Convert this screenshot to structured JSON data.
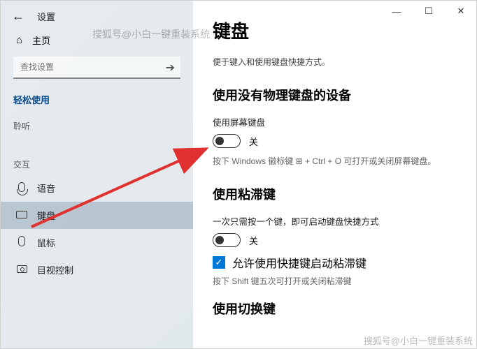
{
  "window": {
    "title": "设置",
    "controls": {
      "min": "—",
      "max": "☐",
      "close": "✕"
    }
  },
  "sidebar": {
    "home": "主页",
    "search_placeholder": "查找设置",
    "category": "轻松使用",
    "group_hearing": "聆听",
    "group_interaction": "交互",
    "items": {
      "speech": "语音",
      "keyboard": "键盘",
      "mouse": "鼠标",
      "eye": "目视控制"
    }
  },
  "main": {
    "title": "键盘",
    "subtitle": "便于键入和使用键盘快捷方式。",
    "sec1": {
      "heading": "使用没有物理键盘的设备",
      "label": "使用屏幕键盘",
      "state": "关",
      "hint": "按下 Windows 徽标键 ⊞ + Ctrl + O 可打开或关闭屏幕键盘。"
    },
    "sec2": {
      "heading": "使用粘滞键",
      "label": "一次只需按一个键，即可启动键盘快捷方式",
      "state": "关",
      "check_label": "允许使用快捷键启动粘滞键",
      "hint": "按下 Shift 键五次可打开或关闭粘滞键"
    },
    "sec3": {
      "heading": "使用切换键"
    }
  },
  "watermark1": "搜狐号@小白一键重装系统",
  "watermark2": "搜狐号@小白一键重装系统"
}
